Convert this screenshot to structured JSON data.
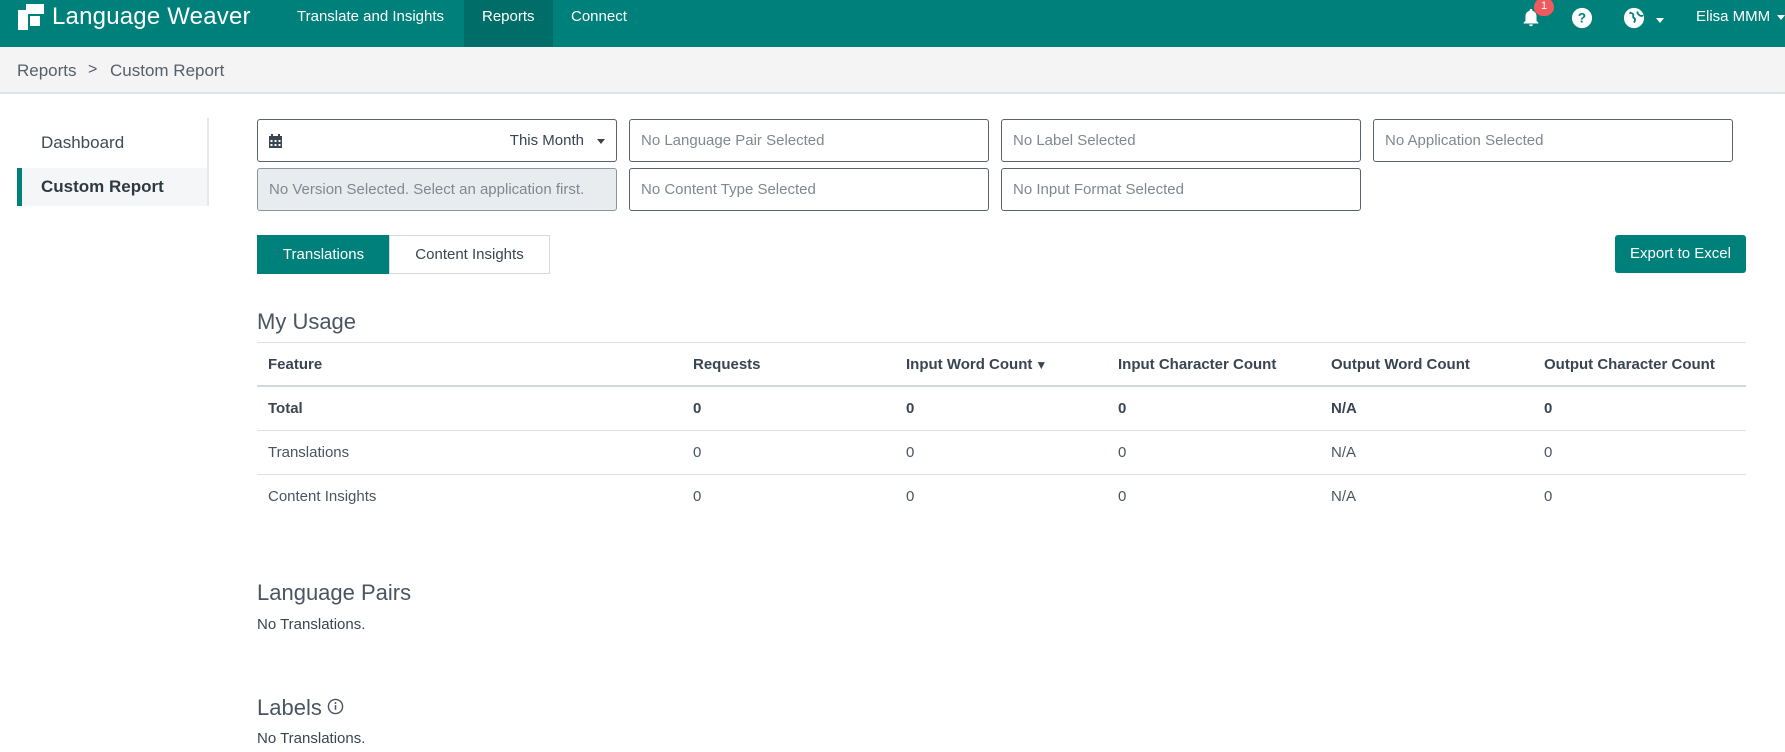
{
  "app": {
    "name": "Language Weaver",
    "brand_color": "#00807b",
    "active_nav_color": "#006d69"
  },
  "nav": {
    "items": [
      {
        "label": "Translate and Insights"
      },
      {
        "label": "Reports"
      },
      {
        "label": "Connect"
      }
    ],
    "active": "Reports"
  },
  "topbar": {
    "notifications_count": "1",
    "notification_icon": "bell-icon",
    "help_icon": "question-circle-icon",
    "language_icon": "globe-icon",
    "user_name": "Elisa MMM"
  },
  "breadcrumb": {
    "root": "Reports",
    "separator": ">",
    "current": "Custom Report"
  },
  "sidebar": {
    "items": [
      {
        "label": "Dashboard"
      },
      {
        "label": "Custom Report"
      }
    ],
    "active": "Custom Report"
  },
  "filters": {
    "date_range": "This Month",
    "language_pair": "No Language Pair Selected",
    "label": "No Label Selected",
    "application": "No Application Selected",
    "version": "No Version Selected. Select an application first.",
    "content_type": "No Content Type Selected",
    "input_format": "No Input Format Selected"
  },
  "tabs": [
    {
      "label": "Translations"
    },
    {
      "label": "Content Insights"
    }
  ],
  "active_tab": "Translations",
  "export_label": "Export to Excel",
  "usage": {
    "title": "My Usage",
    "columns": [
      "Feature",
      "Requests",
      "Input Word Count",
      "Input Character Count",
      "Output Word Count",
      "Output Character Count"
    ],
    "sorted_column": "Input Word Count",
    "sort_indicator": "▼",
    "rows": [
      [
        "Total",
        "0",
        "0",
        "0",
        "N/A",
        "0"
      ],
      [
        "Translations",
        "0",
        "0",
        "0",
        "N/A",
        "0"
      ],
      [
        "Content Insights",
        "0",
        "0",
        "0",
        "N/A",
        "0"
      ]
    ]
  },
  "language_pairs": {
    "title": "Language Pairs",
    "empty": "No Translations."
  },
  "labels": {
    "title": "Labels",
    "empty": "No Translations.",
    "info_icon": "info-circle-icon"
  }
}
